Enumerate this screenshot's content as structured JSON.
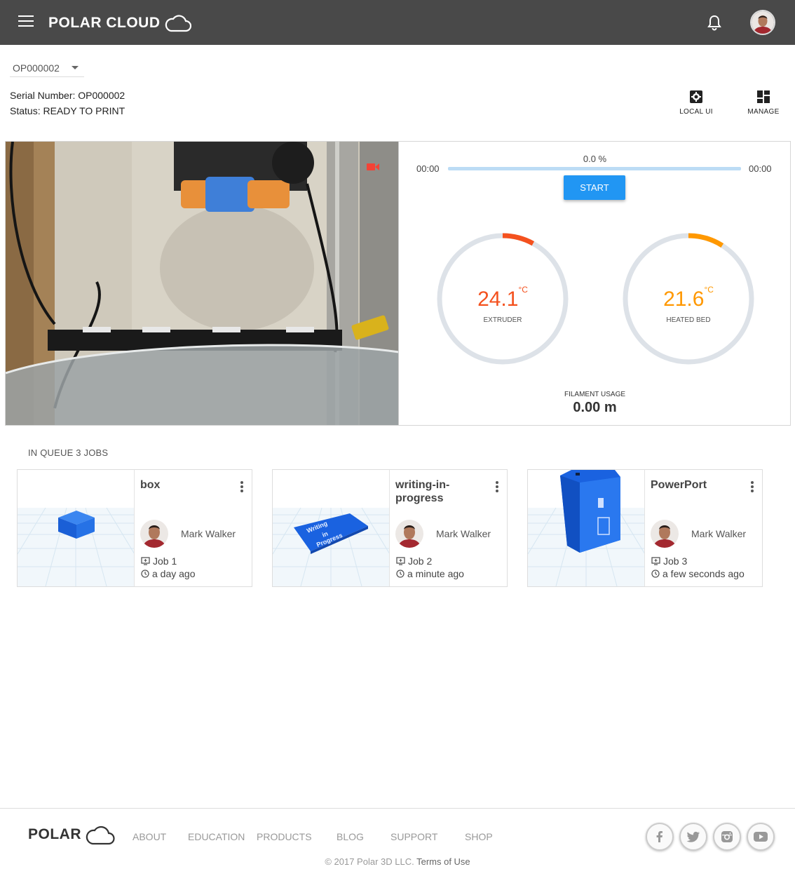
{
  "header": {
    "brand": "POLAR CLOUD",
    "icons": [
      "menu-icon",
      "cloud-icon",
      "bell-icon",
      "user-avatar"
    ]
  },
  "printer": {
    "selected": "OP000002",
    "serial_label": "Serial Number: OP000002",
    "status_label": "Status: READY TO PRINT",
    "actions": {
      "local_ui": "LOCAL UI",
      "manage": "MANAGE"
    }
  },
  "progress": {
    "elapsed": "00:00",
    "remaining": "00:00",
    "percent_label": "0.0 %",
    "fraction": 0.0,
    "start_label": "START"
  },
  "gauges": {
    "extruder": {
      "value": "24.1",
      "unit": "°C",
      "label": "EXTRUDER",
      "color": "#f4511e",
      "fraction": 0.08
    },
    "bed": {
      "value": "21.6",
      "unit": "°C",
      "label": "HEATED BED",
      "color": "#ff9800",
      "fraction": 0.09
    }
  },
  "filament": {
    "label": "FILAMENT USAGE",
    "value": "0.00 m"
  },
  "queue": {
    "title": "IN QUEUE 3 JOBS",
    "jobs": [
      {
        "name": "box",
        "owner": "Mark Walker",
        "job": "Job 1",
        "time": "a day ago"
      },
      {
        "name": "writing-in-progress",
        "owner": "Mark Walker",
        "job": "Job 2",
        "time": "a minute ago"
      },
      {
        "name": "PowerPort",
        "owner": "Mark Walker",
        "job": "Job 3",
        "time": "a few seconds ago"
      }
    ]
  },
  "footer": {
    "logo": "POLAR",
    "links": [
      "ABOUT",
      "EDUCATION",
      "PRODUCTS",
      "BLOG",
      "SUPPORT",
      "SHOP"
    ],
    "social": [
      "facebook-icon",
      "twitter-icon",
      "instagram-icon",
      "youtube-icon"
    ],
    "copyright": "© 2017 Polar 3D LLC.",
    "terms": "Terms of Use"
  },
  "colors": {
    "topbar": "#494949",
    "accent": "#2196f3",
    "track": "#dde2e8",
    "model_blue": "#1a6fe8"
  }
}
